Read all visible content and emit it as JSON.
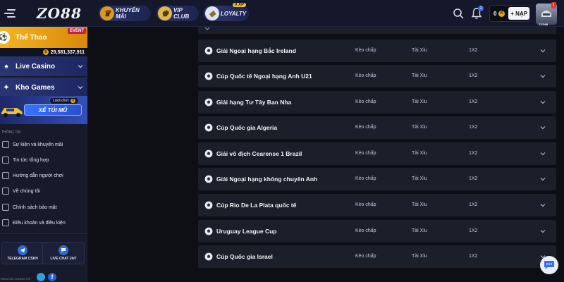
{
  "header": {
    "logo": "ZO88",
    "promo_label": "KHUYẾN MÃI",
    "vip_label": "VIP CLUB",
    "loyalty_label": "LOYALTY",
    "loyalty_badge": "0 XP",
    "notification_count": "1",
    "wallet_balance": "0",
    "coin_symbol": "K",
    "deposit_label": "+ NẠP",
    "avatar_alert": "!",
    "avatar_tag": "T.ZO88"
  },
  "sidebar": {
    "sports_label": "Thể Thao",
    "event_badge": "EVENT",
    "jackpot_amount": "29,581,337,911",
    "casino_label": "Live Casino",
    "games_label": "Kho Games",
    "promo_turns_label": "Lượt chơi:",
    "promo_turns_count": "0",
    "promo_button": "XẾ TÚI MŨ",
    "section_title": "THÔNG TIN",
    "info_links": [
      "Sự kiện và khuyến mãi",
      "Tin tức tổng hợp",
      "Hướng dẫn người chơi",
      "Về chúng tôi",
      "Chính sách bảo mật",
      "Điều khoản và điều kiện"
    ],
    "telegram_label": "TELEGRAM CSKH",
    "live_chat_label": "LIVE CHAT 24/7",
    "follow_label": "THEO DÕI CHÚNG TÔI"
  },
  "leagues": [
    {
      "name": "Giải Ngoại hạng Bắc Ireland",
      "col_a": "Kèo chấp",
      "col_b": "Tài Xỉu",
      "col_c": "1X2"
    },
    {
      "name": "Cúp Quốc tế Ngoại hạng Anh U21",
      "col_a": "Kèo chấp",
      "col_b": "Tài Xỉu",
      "col_c": "1X2"
    },
    {
      "name": "Giải hạng Tư Tây Ban Nha",
      "col_a": "Kèo chấp",
      "col_b": "Tài Xỉu",
      "col_c": "1X2"
    },
    {
      "name": "Cúp Quốc gia Algeria",
      "col_a": "Kèo chấp",
      "col_b": "Tài Xỉu",
      "col_c": "1X2"
    },
    {
      "name": "Giải vô địch Cearense 1 Brazil",
      "col_a": "Kèo chấp",
      "col_b": "Tài Xỉu",
      "col_c": "1X2"
    },
    {
      "name": "Giải Ngoại hạng không chuyên Anh",
      "col_a": "Kèo chấp",
      "col_b": "Tài Xỉu",
      "col_c": "1X2"
    },
    {
      "name": "Cúp Rio De La Plata quốc tế",
      "col_a": "Kèo chấp",
      "col_b": "Tài Xỉu",
      "col_c": "1X2"
    },
    {
      "name": "Uruguay League Cup",
      "col_a": "Kèo chấp",
      "col_b": "Tài Xỉu",
      "col_c": "1X2"
    },
    {
      "name": "Cúp Quốc gia Israel",
      "col_a": "Kèo chấp",
      "col_b": "Tài Xỉu",
      "col_c": "1X2"
    }
  ],
  "icons": {
    "menu": "hamburger-icon",
    "search": "search-icon",
    "bell": "bell-icon",
    "league": "soccer-ball-icon",
    "expand": "chevron-down-icon",
    "chat": "chat-bubble-icon"
  },
  "colors": {
    "sports_accent": "#f3b522",
    "nav_blue": "#2a3674",
    "row_bg": "#1b1f2a",
    "page_bg": "#0d0f15"
  }
}
